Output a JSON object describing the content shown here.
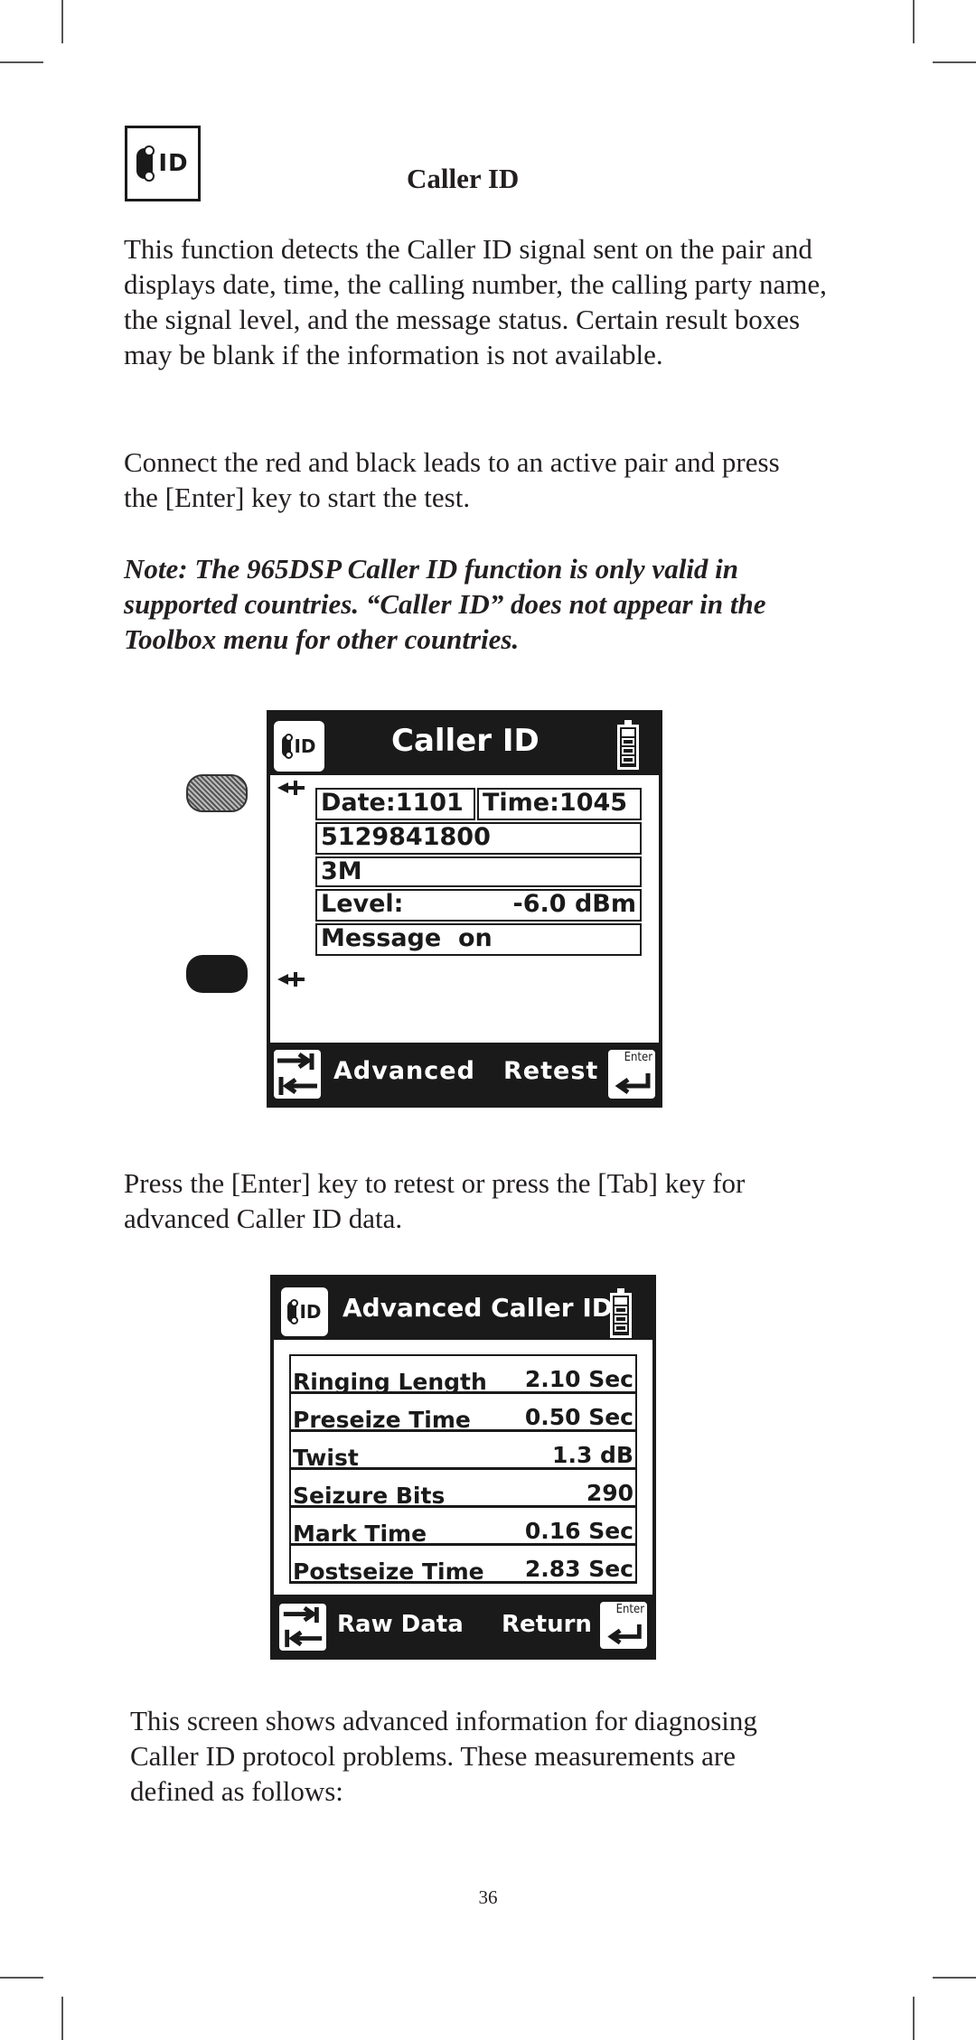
{
  "page": {
    "title": "Caller ID",
    "page_number": "36",
    "paragraphs": {
      "intro": "This function detects the Caller ID signal sent on the pair and displays date, time, the calling number, the calling party name, the signal level, and the message status. Certain result boxes may be blank if the information is not available.",
      "connect": "Connect the red and black leads to an active pair and press the [Enter] key to start the test.",
      "note": "Note:  The 965DSP Caller ID function is only valid in supported countries. “Caller ID” does not appear in the Toolbox menu for other countries.",
      "retest": "Press the [Enter] key to retest or press the [Tab] key for advanced Caller ID data.",
      "advanced_info": "This screen shows advanced information for diagnosing Caller ID protocol problems.  These measurements are defined as follows:"
    },
    "icon": "caller-id-icon"
  },
  "screen1": {
    "header": {
      "title": "Caller ID",
      "icon_text": "ID",
      "battery_level": 0.25
    },
    "fields": {
      "date_label": "Date:",
      "date_value": "1101",
      "time_label": "Time:",
      "time_value": "1045",
      "number": "5129841800",
      "name": "3M",
      "level_label": "Level:",
      "level_value": "-6.0 dBm",
      "message": "Message  on"
    },
    "footer": {
      "left_label": "Advanced",
      "right_label": "Retest",
      "enter_key_label": "Enter"
    }
  },
  "screen2": {
    "header": {
      "title": "Advanced Caller ID",
      "icon_text": "ID",
      "battery_level": 0.25
    },
    "rows": [
      {
        "label": "Ringing Length",
        "value": "2.10 Sec"
      },
      {
        "label": "Preseize Time",
        "value": "0.50 Sec"
      },
      {
        "label": "Twist",
        "value": "1.3 dB"
      },
      {
        "label": "Seizure Bits",
        "value": "290"
      },
      {
        "label": "Mark Time",
        "value": "0.16 Sec"
      },
      {
        "label": "Postseize Time",
        "value": "2.83 Sec"
      }
    ],
    "footer": {
      "left_label": "Raw Data",
      "right_label": "Return",
      "enter_key_label": "Enter"
    }
  }
}
